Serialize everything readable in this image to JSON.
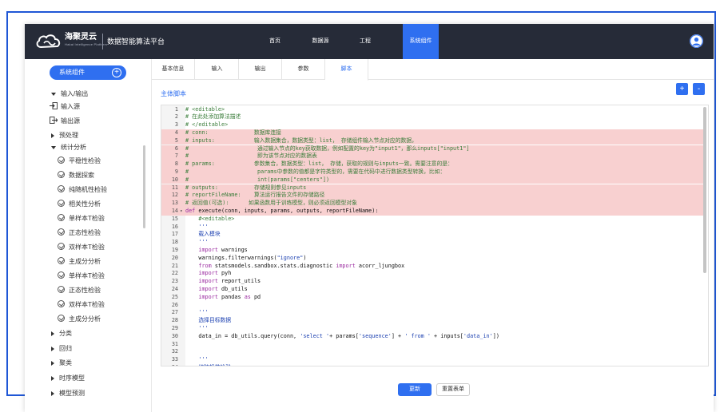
{
  "header": {
    "brand_name": "海聚灵云",
    "brand_sub": "Hakai Intelligence Platform",
    "platform_title": "数据智能算法平台",
    "nav": [
      "首页",
      "数据源",
      "工程",
      "系统组件"
    ],
    "active_nav": "系统组件"
  },
  "sidebar": {
    "components_button": "系统组件",
    "items": [
      {
        "label": "输入/输出",
        "icon": "caret-down-icon"
      },
      {
        "label": "输入源",
        "icon": "input-icon"
      },
      {
        "label": "输出源",
        "icon": "output-icon"
      },
      {
        "label": "预处理",
        "icon": "caret-right-icon"
      },
      {
        "label": "统计分析",
        "icon": "caret-down-icon"
      },
      {
        "label": "平稳性检验",
        "icon": "check-circle-icon"
      },
      {
        "label": "数据探索",
        "icon": "check-circle-icon"
      },
      {
        "label": "纯随机性检验",
        "icon": "check-circle-icon"
      },
      {
        "label": "相关性分析",
        "icon": "check-circle-icon"
      },
      {
        "label": "单样本T检验",
        "icon": "check-circle-icon"
      },
      {
        "label": "正态性检验",
        "icon": "check-circle-icon"
      },
      {
        "label": "双样本T检验",
        "icon": "check-circle-icon"
      },
      {
        "label": "主成分分析",
        "icon": "check-circle-icon"
      },
      {
        "label": "单样本T检验",
        "icon": "check-circle-icon"
      },
      {
        "label": "正态性检验",
        "icon": "check-circle-icon"
      },
      {
        "label": "双样本T检验",
        "icon": "check-circle-icon"
      },
      {
        "label": "主成分分析",
        "icon": "check-circle-icon"
      },
      {
        "label": "分类",
        "icon": "caret-right-icon"
      },
      {
        "label": "回归",
        "icon": "caret-right-icon"
      },
      {
        "label": "聚类",
        "icon": "caret-right-icon"
      },
      {
        "label": "时序模型",
        "icon": "caret-right-icon"
      },
      {
        "label": "模型预测",
        "icon": "caret-right-icon"
      }
    ]
  },
  "tabs": [
    "基本信息",
    "输入",
    "输出",
    "参数",
    "脚本"
  ],
  "active_tab": "脚本",
  "main": {
    "section_title": "主体脚本",
    "zoom_in_label": "+",
    "zoom_out_label": "-",
    "update_button": "更新",
    "reset_button": "重置表单"
  },
  "code": [
    {
      "n": "1",
      "t": "# <editable>",
      "k": "com"
    },
    {
      "n": "2",
      "t": "# 在此处添加算法描述",
      "k": "com"
    },
    {
      "n": "3",
      "t": "# </editable>",
      "k": "com"
    },
    {
      "n": "4",
      "t": "# conn:              数据库连接",
      "k": "com",
      "hl": true
    },
    {
      "n": "5",
      "t": "# inputs:            输入数据集合，数据类型：list， 存储组件输入节点对应的数据，",
      "k": "com",
      "hl": true
    },
    {
      "n": "6",
      "t": "#                     通过输入节点的key获取数据，例如配置的key为\"input1\"，那么inputs[\"input1\"]",
      "k": "com",
      "hl": true
    },
    {
      "n": "7",
      "t": "#                     即为该节点对应的数据表",
      "k": "com",
      "hl": true
    },
    {
      "n": "8",
      "t": "# params:            参数集合，数据类型：list， 存储，获取的规则与inputs一致。需要注意的是：",
      "k": "com",
      "hl": true
    },
    {
      "n": "9",
      "t": "#                     params中参数的值都是字符类型的，需要在代码中进行数据类型转换，比如：",
      "k": "com",
      "hl": true
    },
    {
      "n": "10",
      "t": "#                     int(params[\"centers\"])",
      "k": "com",
      "hl": true
    },
    {
      "n": "11",
      "t": "# outputs:           存储规则参见inputs",
      "k": "com",
      "hl": true
    },
    {
      "n": "12",
      "t": "# reportFileName:    算法运行报告文件的存储路径",
      "k": "com",
      "hl": true
    },
    {
      "n": "13",
      "t": "# 返回值(可选):      如果函数用于训练模型，则必须返回模型对象",
      "k": "com",
      "hl": true
    },
    {
      "n": "14",
      "t": "def execute(conn, inputs, params, outputs, reportFileName):",
      "k": "def",
      "hl": true,
      "fold": true
    },
    {
      "n": "15",
      "t": "    #<editable>",
      "k": "com"
    },
    {
      "n": "16",
      "t": "    '''",
      "k": "str"
    },
    {
      "n": "17",
      "t": "    载入模块",
      "k": "str"
    },
    {
      "n": "18",
      "t": "    '''",
      "k": "str"
    },
    {
      "n": "19",
      "t": "    import warnings",
      "k": "imp"
    },
    {
      "n": "20",
      "t": "    warnings.filterwarnings(\"ignore\")",
      "k": "filt"
    },
    {
      "n": "21",
      "t": "    from statsmodels.sandbox.stats.diagnostic import acorr_ljungbox",
      "k": "from"
    },
    {
      "n": "22",
      "t": "    import pyh",
      "k": "imp"
    },
    {
      "n": "23",
      "t": "    import report_utils",
      "k": "imp"
    },
    {
      "n": "24",
      "t": "    import db_utils",
      "k": "imp"
    },
    {
      "n": "25",
      "t": "    import pandas as pd",
      "k": "as"
    },
    {
      "n": "26",
      "t": "",
      "k": "plain"
    },
    {
      "n": "27",
      "t": "    '''",
      "k": "str"
    },
    {
      "n": "28",
      "t": "    选择目标数据",
      "k": "str"
    },
    {
      "n": "29",
      "t": "    '''",
      "k": "str"
    },
    {
      "n": "30",
      "t": "    data_in = db_utils.query(conn, 'select '+ params['sequence'] + ' from ' + inputs['data_in'])",
      "k": "query"
    },
    {
      "n": "31",
      "t": "",
      "k": "plain"
    },
    {
      "n": "32",
      "t": "",
      "k": "plain"
    },
    {
      "n": "33",
      "t": "    '''",
      "k": "str"
    },
    {
      "n": "34",
      "t": "    纯随机性检验",
      "k": "str"
    }
  ],
  "colors": {
    "header_bg": "#262b38",
    "accent": "#2f6ff0",
    "highlight": "#f8d0d0",
    "comment": "#3a7d3a",
    "keyword": "#9b2ba0",
    "string": "#1a3fb0"
  }
}
